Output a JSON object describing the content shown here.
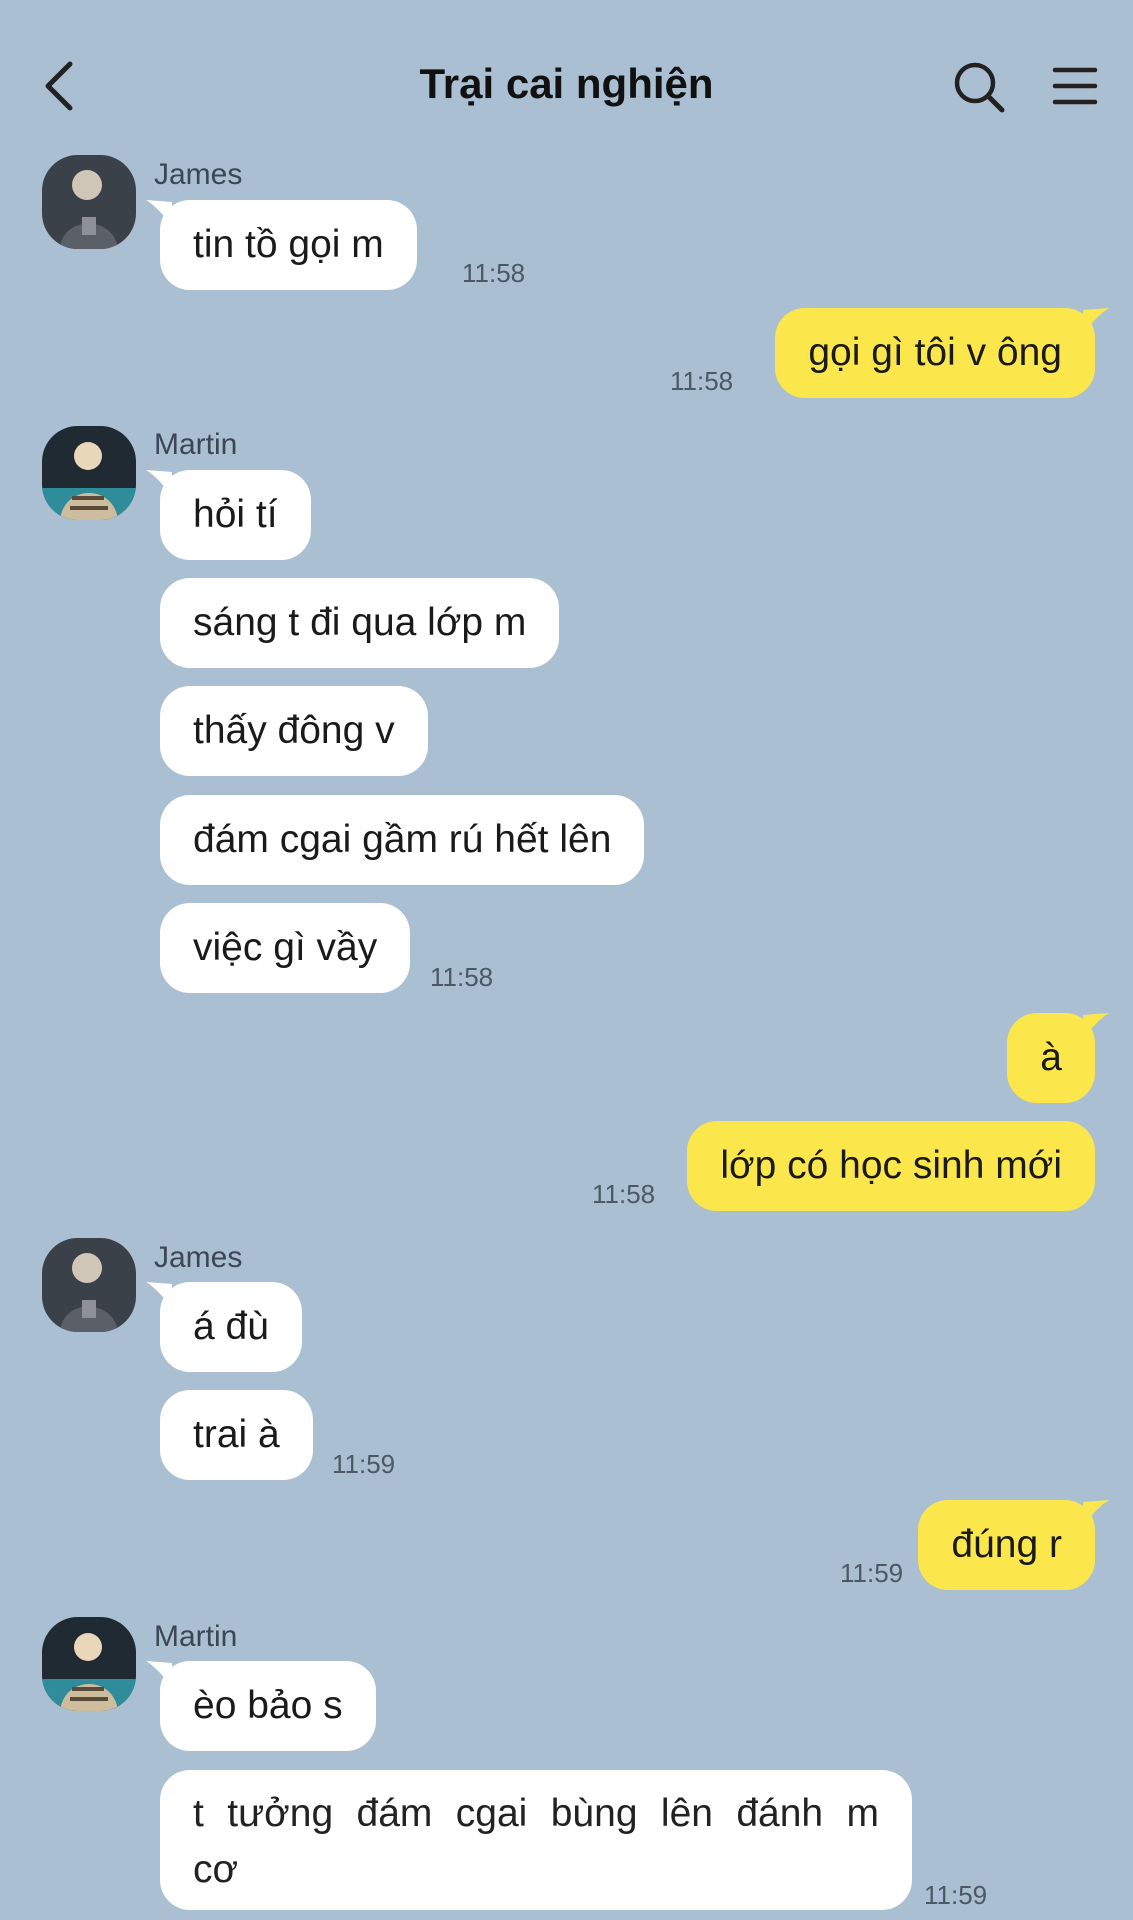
{
  "header": {
    "title": "Trại cai nghiện",
    "back_icon": "chevron-left-icon",
    "search_icon": "search-icon",
    "menu_icon": "hamburger-menu-icon"
  },
  "colors": {
    "background": "#abbfd3",
    "incoming_bubble": "#ffffff",
    "outgoing_bubble": "#fbe74b"
  },
  "messages": {
    "g1": {
      "sender": "James",
      "m1": "tin tồ gọi m",
      "time": "11:58"
    },
    "o1": {
      "m1": "gọi gì tôi v ông",
      "time": "11:58"
    },
    "g2": {
      "sender": "Martin",
      "m1": "hỏi tí",
      "m2": "sáng t đi qua lớp m",
      "m3": "thấy đông v",
      "m4": "đám cgai gầm rú hết lên",
      "m5": "việc gì vầy",
      "time": "11:58"
    },
    "o2": {
      "m1": "à",
      "m2": "lớp có học sinh mới",
      "time": "11:58"
    },
    "g3": {
      "sender": "James",
      "m1": "á đù",
      "m2": "trai à",
      "time": "11:59"
    },
    "o3": {
      "m1": "đúng r",
      "time": "11:59"
    },
    "g4": {
      "sender": "Martin",
      "m1": "èo bảo s",
      "m2_line1": "t tưởng đám cgai bùng lên đánh m",
      "m2_line2": "cơ",
      "time": "11:59"
    }
  }
}
